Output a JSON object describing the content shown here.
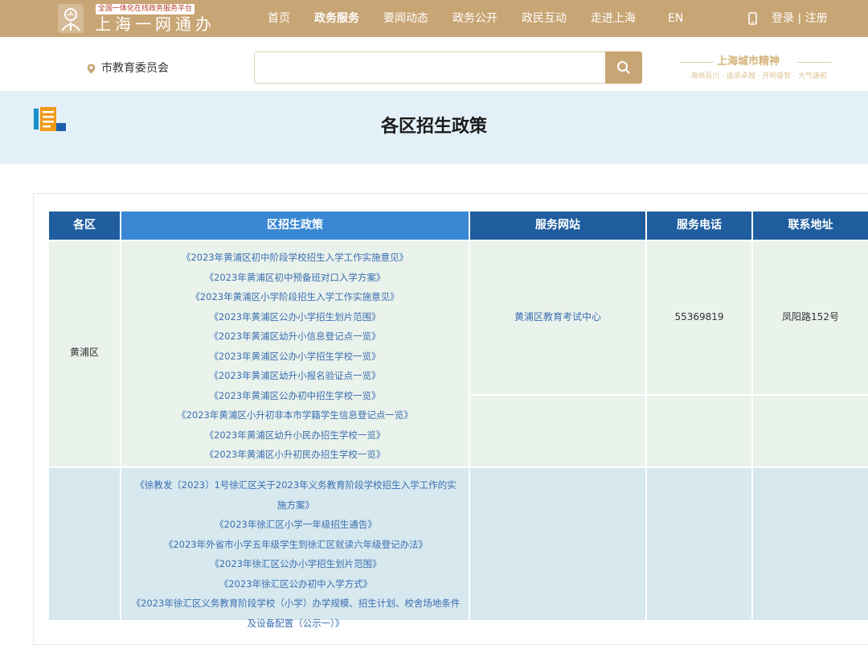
{
  "header": {
    "platform_badge": "全国一体化在线政务服务平台",
    "logo_text": "上海一网通办",
    "nav": [
      {
        "label": "首页",
        "active": false
      },
      {
        "label": "政务服务",
        "active": true
      },
      {
        "label": "要闻动态",
        "active": false
      },
      {
        "label": "政务公开",
        "active": false
      },
      {
        "label": "政民互动",
        "active": false
      },
      {
        "label": "走进上海",
        "active": false
      },
      {
        "label": "EN",
        "active": false
      }
    ],
    "login_label": "登录 | 注册",
    "brand_color": "#c8a574"
  },
  "search": {
    "location": "市教育委员会",
    "placeholder": "",
    "value": ""
  },
  "spirit": {
    "title": "上海城市精神",
    "subtitle": "海纳百川 · 追求卓越 · 开明睿智 · 大气谦和"
  },
  "page": {
    "title": "各区招生政策"
  },
  "table": {
    "headers": [
      "各区",
      "区招生政策",
      "服务网站",
      "服务电话",
      "联系地址"
    ],
    "header_colors": {
      "dark": "#1f5d9f",
      "light": "#3a88d3"
    },
    "rows": [
      {
        "district": "黄浦区",
        "policies": [
          "《2023年黄浦区初中阶段学校招生入学工作实施意见》",
          "《2023年黄浦区初中预备班对口入学方案》",
          "《2023年黄浦区小学阶段招生入学工作实施意见》",
          "《2023年黄浦区公办小学招生划片范围》",
          "《2023年黄浦区幼升小信息登记点一览》",
          "《2023年黄浦区公办小学招生学校一览》",
          "《2023年黄浦区幼升小报名验证点一览》",
          "《2023年黄浦区公办初中招生学校一览》",
          "《2023年黄浦区小升初非本市学籍学生信息登记点一览》",
          "《2023年黄浦区幼升小民办招生学校一览》",
          "《2023年黄浦区小升初民办招生学校一览》"
        ],
        "website": "黄浦区教育考试中心",
        "phone": "55369819",
        "address": "凤阳路152号"
      },
      {
        "district": "",
        "policies": [
          "《徐教发〔2023〕1号徐汇区关于2023年义务教育阶段学校招生入学工作的实施方案》",
          "《2023年徐汇区小学一年级招生通告》",
          "《2023年外省市小学五年级学生到徐汇区就读六年级登记办法》",
          "《2023年徐汇区公办小学招生划片范围》",
          "《2023年徐汇区公办初中入学方式》",
          "《2023年徐汇区义务教育阶段学校（小学）办学规模、招生计划、校舍场地条件及设备配置（公示一）》"
        ],
        "website": "",
        "phone": "",
        "address": ""
      }
    ]
  }
}
